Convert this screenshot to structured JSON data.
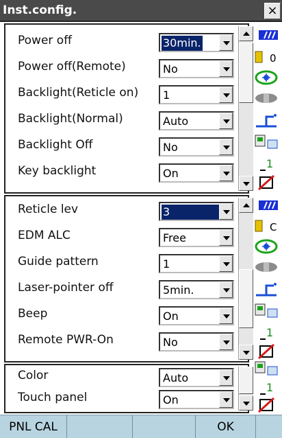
{
  "window": {
    "title": "Inst.config.",
    "close_label": "×"
  },
  "panels": [
    {
      "rows": [
        {
          "label": "Power off",
          "value": "30min.",
          "selected": true
        },
        {
          "label": "Power off(Remote)",
          "value": "No",
          "selected": false
        },
        {
          "label": "Backlight(Reticle on)",
          "value": "1",
          "selected": false
        },
        {
          "label": "Backlight(Normal)",
          "value": "Auto",
          "selected": false
        },
        {
          "label": "Backlight Off",
          "value": "No",
          "selected": false
        },
        {
          "label": "Key backlight",
          "value": "On",
          "selected": false
        }
      ]
    },
    {
      "rows": [
        {
          "label": "Reticle lev",
          "value": "3",
          "selected": true
        },
        {
          "label": "EDM ALC",
          "value": "Free",
          "selected": false
        },
        {
          "label": "Guide pattern",
          "value": "1",
          "selected": false
        },
        {
          "label": "Laser-pointer off",
          "value": "5min.",
          "selected": false
        },
        {
          "label": "Beep",
          "value": "On",
          "selected": false
        },
        {
          "label": "Remote PWR-On",
          "value": "No",
          "selected": false
        }
      ]
    },
    {
      "rows": [
        {
          "label": "Color",
          "value": "Auto",
          "selected": false
        },
        {
          "label": "Touch panel",
          "value": "On",
          "selected": false
        }
      ]
    }
  ],
  "status_icons": {
    "battery_text": "0",
    "battery_text_2": "C",
    "channel_1": "1",
    "icons": [
      "signal-icon",
      "battery-icon",
      "target-icon",
      "prism-icon",
      "laser-plummet-icon",
      "interface-icon",
      "channel-icon",
      "memo-icon"
    ]
  },
  "softkeys": [
    "PNL CAL",
    "",
    "",
    "OK",
    ""
  ]
}
